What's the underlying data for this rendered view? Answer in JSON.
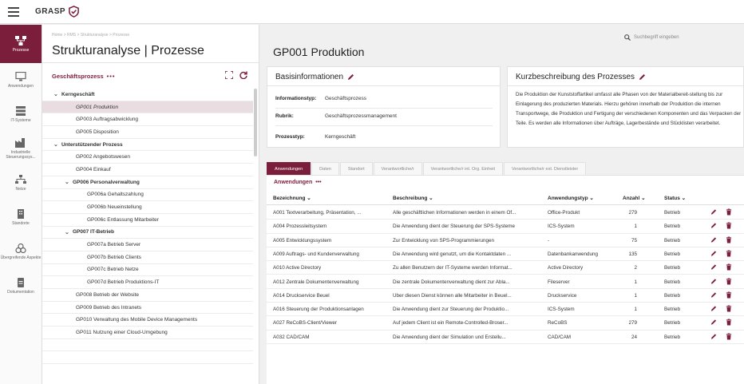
{
  "app": {
    "brand": "GRASP",
    "colors": {
      "accent": "#7b1e3c",
      "background": "#f0f0f0"
    }
  },
  "rail": {
    "items": [
      {
        "label": "Prozesse",
        "icon": "process-icon",
        "active": true
      },
      {
        "label": "Anwendungen",
        "icon": "monitor-icon",
        "active": false
      },
      {
        "label": "IT-Systeme",
        "icon": "server-icon",
        "active": false
      },
      {
        "label": "Industrielle Steuerungssys...",
        "icon": "factory-icon",
        "active": false
      },
      {
        "label": "Netze",
        "icon": "network-icon",
        "active": false
      },
      {
        "label": "Standorte",
        "icon": "building-icon",
        "active": false
      },
      {
        "label": "Übergreifende Aspekte",
        "icon": "cross-aspects-icon",
        "active": false
      },
      {
        "label": "Dokumentation",
        "icon": "document-icon",
        "active": false
      }
    ]
  },
  "tree_panel": {
    "breadcrumb": "Home > RMS > Strukturanalyse > Prozesse",
    "title": "Strukturanalyse | Prozesse",
    "section_label": "Geschäftsprozess",
    "section_dots": "•••",
    "rows": [
      {
        "label": "Kerngeschäft",
        "group": true,
        "chevron": "⌄",
        "selected": false
      },
      {
        "label": "GP001 Produktion",
        "group": false,
        "chevron": "",
        "selected": true
      },
      {
        "label": "GP003 Auftragsabwicklung",
        "group": false,
        "chevron": "",
        "selected": false
      },
      {
        "label": "GP005 Disposition",
        "group": false,
        "chevron": "",
        "selected": false
      },
      {
        "label": "Unterstützender Prozess",
        "group": true,
        "chevron": "⌄",
        "selected": false
      },
      {
        "label": "GP002 Angebotswesen",
        "group": false,
        "chevron": "",
        "selected": false
      },
      {
        "label": "GP004 Einkauf",
        "group": false,
        "chevron": "",
        "selected": false
      },
      {
        "label": "GP006 Personalverwaltung",
        "group": true,
        "chevron": "⌄",
        "selected": false
      },
      {
        "label": "GP006a Gehaltszahlung",
        "group": false,
        "chevron": "",
        "selected": false
      },
      {
        "label": "GP006b Neueinstellung",
        "group": false,
        "chevron": "",
        "selected": false
      },
      {
        "label": "GP006c Entlassung Mitarbeiter",
        "group": false,
        "chevron": "",
        "selected": false
      },
      {
        "label": "GP007 IT-Betrieb",
        "group": true,
        "chevron": "⌄",
        "selected": false
      },
      {
        "label": "GP007a Betrieb Server",
        "group": false,
        "chevron": "",
        "selected": false
      },
      {
        "label": "GP007b Betrieb Clients",
        "group": false,
        "chevron": "",
        "selected": false
      },
      {
        "label": "GP007c Betrieb Netze",
        "group": false,
        "chevron": "",
        "selected": false
      },
      {
        "label": "GP007d Betrieb Produktions-IT",
        "group": false,
        "chevron": "",
        "selected": false
      },
      {
        "label": "GP008 Betrieb der Website",
        "group": false,
        "chevron": "",
        "selected": false
      },
      {
        "label": "GP009 Betrieb des Intranets",
        "group": false,
        "chevron": "",
        "selected": false
      },
      {
        "label": "GP010 Verwaltung des Mobile Device Managements",
        "group": false,
        "chevron": "",
        "selected": false
      },
      {
        "label": "GP011 Nutzung einer Cloud-Umgebung",
        "group": false,
        "chevron": "",
        "selected": false
      },
      {
        "label": "",
        "group": false,
        "chevron": "",
        "selected": false
      },
      {
        "label": "",
        "group": false,
        "chevron": "",
        "selected": false
      }
    ]
  },
  "main": {
    "search_placeholder": "Suchbegriff eingeben",
    "title": "GP001 Produktion",
    "basis": {
      "heading": "Basisinformationen",
      "fields": [
        {
          "key": "Informationstyp:",
          "value": "Geschäftsprozess"
        },
        {
          "key": "Rubrik:",
          "value": "Geschäftsprozessmanagement"
        },
        {
          "key": "Prozesstyp:",
          "value": "Kerngeschäft"
        }
      ]
    },
    "kurz": {
      "heading": "Kurzbeschreibung des Prozesses",
      "text": "Die Produktion der Kunststoffartikel umfasst alle Phasen von der Materialbereit-stellung bis zur Einlagerung des produzierten Materials. Hierzu gehören innerhalb der Produktion die internen Transportwege, die Produktion und Fertigung der verschiedenen Komponenten und das Verpacken der Teile. Es werden alle Informationen über Aufträge, Lagerbestände und Stücklisten verarbeitet."
    },
    "tabs": [
      {
        "label": "Anwendungen",
        "active": true
      },
      {
        "label": "Daten",
        "active": false
      },
      {
        "label": "Standort",
        "active": false
      },
      {
        "label": "Verantwortliche/r",
        "active": false
      },
      {
        "label": "Verantwortliche/r int. Org. Einheit",
        "active": false
      },
      {
        "label": "Verantwortliche/r ext. Dienstleister",
        "active": false
      }
    ],
    "table": {
      "section_label": "Anwendungen",
      "section_dots": "•••",
      "columns": [
        {
          "label": "Bezeichnung ⌄"
        },
        {
          "label": "Beschreibung ⌄"
        },
        {
          "label": "Anwendungstyp ⌄"
        },
        {
          "label": "Anzahl ⌄"
        },
        {
          "label": "Status ⌄"
        }
      ],
      "rows": [
        {
          "name": "A001 Textverarbeitung, Präsentation, ...",
          "desc": "Alle geschäftlichen Informationen werden in einem Of...",
          "type": "Office-Produkt",
          "count": "279",
          "status": "Betrieb"
        },
        {
          "name": "A004 Prozessleitsystem",
          "desc": "Die Anwendung dient der Steuerung der SPS-Systeme",
          "type": "ICS-System",
          "count": "1",
          "status": "Betrieb"
        },
        {
          "name": "A005 Entwicklungssystem",
          "desc": "Zur Entwicklung von SPS-Programmierungen",
          "type": "-",
          "count": "75",
          "status": "Betrieb"
        },
        {
          "name": "A009 Auftrags- und Kundenverwaltung",
          "desc": "Die Anwendung wird genutzt, um die Kontaktdaten ...",
          "type": "Datenbankanwendung",
          "count": "135",
          "status": "Betrieb"
        },
        {
          "name": "A010 Active Directory",
          "desc": "Zu allen Benutzern der IT-Systeme werden Informat...",
          "type": "Active Directory",
          "count": "2",
          "status": "Betrieb"
        },
        {
          "name": "A012 Zentrale Dokumentenverwaltung",
          "desc": "Die zentrale Dokumentenverwaltung dient zur Abla...",
          "type": "Fileserver",
          "count": "1",
          "status": "Betrieb"
        },
        {
          "name": "A014 Druckservice Beuel",
          "desc": "Über diesen Dienst können alle Mitarbeiter in Beuel...",
          "type": "Druckservice",
          "count": "1",
          "status": "Betrieb"
        },
        {
          "name": "A016 Steuerung der Produktionsanlagen",
          "desc": "Die Anwendung dient zur Steuerung der Produktio...",
          "type": "ICS-System",
          "count": "1",
          "status": "Betrieb"
        },
        {
          "name": "A027 ReCoBS-Client/Viewer",
          "desc": "Auf jedem Client ist ein Remote-Controlled-Broser...",
          "type": "ReCoBS",
          "count": "279",
          "status": "Betrieb"
        },
        {
          "name": "A032 CAD/CAM",
          "desc": "Die Anwendung dient der Simulation und Erstellu...",
          "type": "CAD/CAM",
          "count": "24",
          "status": "Betrieb"
        }
      ]
    }
  }
}
